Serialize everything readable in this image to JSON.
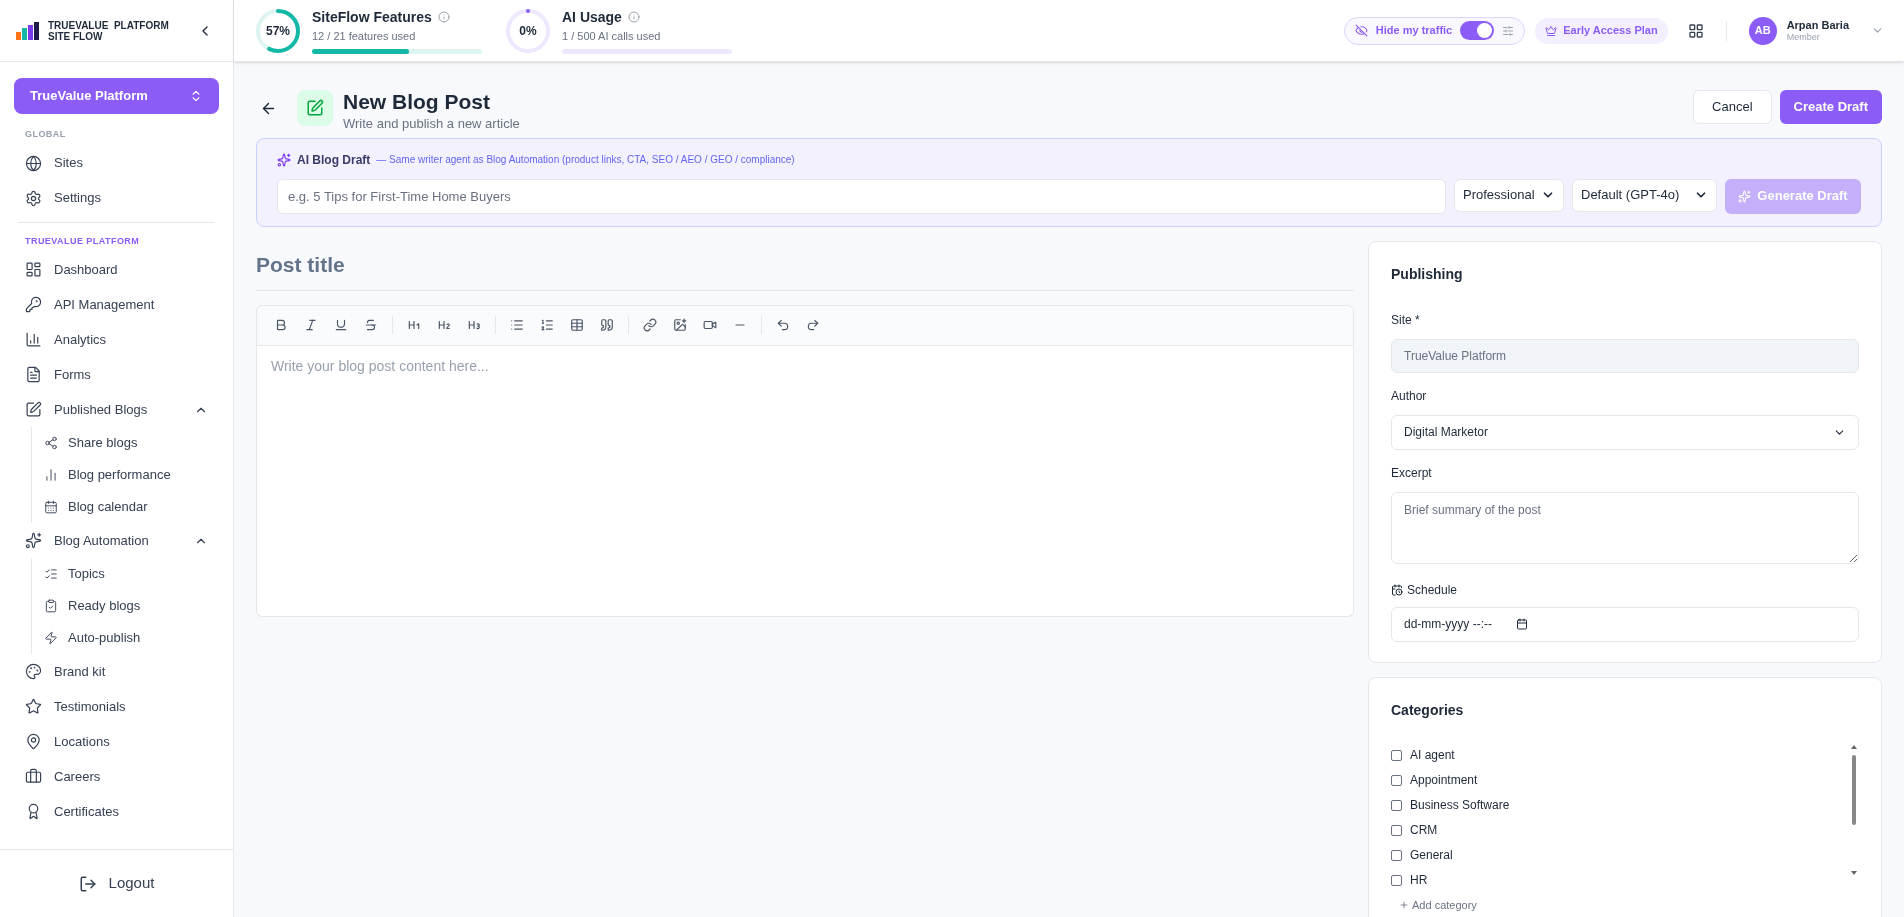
{
  "brand": {
    "line1": "TRUEVALUE  PLATFORM",
    "line2": "SITE FLOW"
  },
  "usage": [
    {
      "title": "SiteFlow Features",
      "percent": "57%",
      "detail": "12 / 21 features used",
      "level": 0.57
    },
    {
      "title": "AI Usage",
      "percent": "0%",
      "detail": "1 / 500 AI calls used",
      "level": 0
    }
  ],
  "traffic": {
    "label": "Hide my traffic",
    "on": true
  },
  "plan": "Early Access Plan",
  "user": {
    "initials": "AB",
    "name": "Arpan Baria",
    "role": "Member"
  },
  "workspace": "TrueValue Platform",
  "sidebar": {
    "sections": [
      {
        "heading": "GLOBAL",
        "kind": "muted",
        "items": [
          {
            "label": "Sites"
          },
          {
            "label": "Settings"
          }
        ]
      },
      {
        "heading": "TRUEVALUE PLATFORM",
        "kind": "accent",
        "items": [
          {
            "label": "Dashboard"
          },
          {
            "label": "API Management"
          },
          {
            "label": "Analytics"
          },
          {
            "label": "Forms"
          },
          {
            "label": "Published Blogs",
            "expanded": true,
            "children": [
              {
                "label": "Share blogs"
              },
              {
                "label": "Blog performance"
              },
              {
                "label": "Blog calendar"
              }
            ]
          },
          {
            "label": "Blog Automation",
            "expanded": true,
            "children": [
              {
                "label": "Topics"
              },
              {
                "label": "Ready blogs"
              },
              {
                "label": "Auto-publish"
              }
            ]
          },
          {
            "label": "Brand kit"
          },
          {
            "label": "Testimonials"
          },
          {
            "label": "Locations"
          },
          {
            "label": "Careers"
          },
          {
            "label": "Certificates"
          }
        ]
      }
    ],
    "logout": "Logout"
  },
  "page": {
    "title": "New Blog Post",
    "subtitle": "Write and publish a new article",
    "buttons": [
      "Cancel",
      "Create Draft"
    ]
  },
  "ai_draft": {
    "title": "AI Blog Draft",
    "note": "— Same writer agent as Blog Automation (product links, CTA, SEO / AEO / GEO / compliance)",
    "placeholder": "e.g. 5 Tips for First-Time Home Buyers",
    "tone": "Professional",
    "model": "Default (GPT-4o)",
    "button": "Generate Draft",
    "disabled": true
  },
  "editor": {
    "title_placeholder": "Post title",
    "body_placeholder": "Write your blog post content here..."
  },
  "publishing": {
    "title": "Publishing",
    "site_label": "Site *",
    "site_value": "TrueValue Platform",
    "author_label": "Author",
    "author_value": "Digital Marketor",
    "excerpt_label": "Excerpt",
    "excerpt_placeholder": "Brief summary of the post",
    "schedule_label": "Schedule",
    "schedule_value": "dd-mm-yyyy --:--"
  },
  "categories": {
    "title": "Categories",
    "items": [
      {
        "label": "AI agent",
        "checked": false
      },
      {
        "label": "Appointment",
        "checked": false
      },
      {
        "label": "Business Software",
        "checked": false
      },
      {
        "label": "CRM",
        "checked": false
      },
      {
        "label": "General",
        "checked": false
      },
      {
        "label": "HR",
        "checked": false
      }
    ],
    "add": "Add category"
  }
}
